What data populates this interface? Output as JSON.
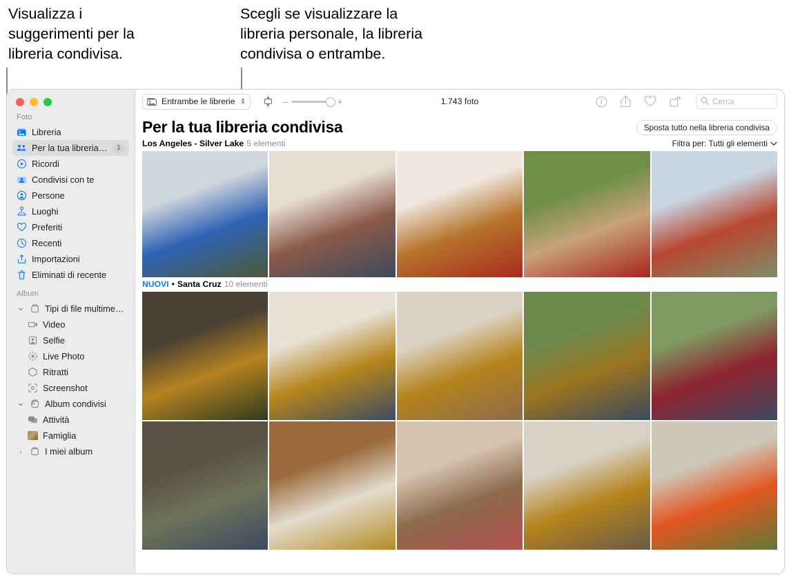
{
  "callouts": {
    "left": "Visualizza i\nsuggerimenti per la\nlibreria condivisa.",
    "right": "Scegli se visualizzare la\nlibreria personale, la libreria\ncondivisa o entrambe."
  },
  "window": {
    "traffic_lights": [
      "close",
      "minimize",
      "zoom"
    ]
  },
  "sidebar": {
    "sections": [
      {
        "title": "Foto",
        "items": [
          {
            "label": "Libreria",
            "icon": "library-icon",
            "badge": null,
            "selected": false
          },
          {
            "label": "Per la tua libreria condivisa",
            "icon": "shared-library-icon",
            "badge": "1",
            "selected": true
          },
          {
            "label": "Ricordi",
            "icon": "memories-icon",
            "badge": null,
            "selected": false
          },
          {
            "label": "Condivisi con te",
            "icon": "shared-with-you-icon",
            "badge": null,
            "selected": false
          },
          {
            "label": "Persone",
            "icon": "people-icon",
            "badge": null,
            "selected": false
          },
          {
            "label": "Luoghi",
            "icon": "places-icon",
            "badge": null,
            "selected": false
          },
          {
            "label": "Preferiti",
            "icon": "heart-icon",
            "badge": null,
            "selected": false
          },
          {
            "label": "Recenti",
            "icon": "clock-icon",
            "badge": null,
            "selected": false
          },
          {
            "label": "Importazioni",
            "icon": "import-icon",
            "badge": null,
            "selected": false
          },
          {
            "label": "Eliminati di recente",
            "icon": "trash-icon",
            "badge": null,
            "selected": false
          }
        ]
      },
      {
        "title": "Album",
        "items": [
          {
            "label": "Tipi di file multimediali",
            "icon": "album-folder-icon",
            "disclosure": "expanded",
            "selected": false
          },
          {
            "label": "Video",
            "icon": "video-icon",
            "sub": true,
            "selected": false
          },
          {
            "label": "Selfie",
            "icon": "selfie-icon",
            "sub": true,
            "selected": false
          },
          {
            "label": "Live Photo",
            "icon": "live-photo-icon",
            "sub": true,
            "selected": false
          },
          {
            "label": "Ritratti",
            "icon": "portrait-icon",
            "sub": true,
            "selected": false
          },
          {
            "label": "Screenshot",
            "icon": "screenshot-icon",
            "sub": true,
            "selected": false
          },
          {
            "label": "Album condivisi",
            "icon": "shared-album-icon",
            "disclosure": "expanded",
            "selected": false
          },
          {
            "label": "Attività",
            "icon": "activity-icon",
            "sub": true,
            "selected": false
          },
          {
            "label": "Famiglia",
            "icon": "album-thumbnail-icon",
            "sub": true,
            "selected": false
          },
          {
            "label": "I miei album",
            "icon": "album-folder-icon",
            "disclosure": "collapsed",
            "selected": false
          }
        ]
      }
    ]
  },
  "toolbar": {
    "library_selector": {
      "label": "Entrambe le librerie",
      "icon": "library-switch-icon"
    },
    "aspect_button_icon": "aspect-ratio-icon",
    "zoom": {
      "minus": "–",
      "plus": "+",
      "value_percent": 82
    },
    "photo_count": "1.743 foto",
    "icons": [
      {
        "name": "info-icon",
        "glyph": "i"
      },
      {
        "name": "share-icon",
        "glyph": "share"
      },
      {
        "name": "favorite-icon",
        "glyph": "heart"
      },
      {
        "name": "rotate-icon",
        "glyph": "rotate"
      }
    ],
    "search": {
      "placeholder": "Cerca",
      "value": "",
      "icon": "search-icon"
    }
  },
  "main": {
    "page_title": "Per la tua libreria condivisa",
    "move_all_button": "Sposta tutto nella libreria condivisa",
    "filter": {
      "label": "Filtra per: Tutti gli elementi",
      "icon": "chevron-down-icon"
    },
    "sections": [
      {
        "new_label": "",
        "separator": "",
        "place": "Los Angeles - Silver Lake",
        "count": "5 elementi",
        "rows": 1,
        "photos": [
          {
            "alt": "bambino con le braccia alzate alla finestra blu",
            "c1": "#cfd6dd",
            "c2": "#2f63b5",
            "c3": "#4d5a34"
          },
          {
            "alt": "due bambini seduti sul letto",
            "c1": "#e6ddd1",
            "c2": "#8b5a4a",
            "c3": "#3c4a5c"
          },
          {
            "alt": "bambino che suona la chitarra",
            "c1": "#efe7de",
            "c2": "#b6742c",
            "c3": "#aa2a1e"
          },
          {
            "alt": "bambino sorridente all'aperto",
            "c1": "#6f8f46",
            "c2": "#c8a27a",
            "c3": "#a8241c"
          },
          {
            "alt": "bambino con megafono blu",
            "c1": "#c9d6e4",
            "c2": "#b7472f",
            "c3": "#7f8e6b"
          }
        ]
      },
      {
        "new_label": "NUOVI",
        "separator": "•",
        "place": "Santa Cruz",
        "count": "10 elementi",
        "rows": 2,
        "photos": [
          {
            "alt": "donna che impasta in cucina con piante",
            "c1": "#4a4033",
            "c2": "#b58320",
            "c3": "#2e3a22"
          },
          {
            "alt": "donna aiuta bambino a impastare",
            "c1": "#e7e1d6",
            "c2": "#b6861d",
            "c3": "#3c4b63"
          },
          {
            "alt": "donna che ride mentre impasta",
            "c1": "#dcd3c5",
            "c2": "#b5841c",
            "c3": "#8d6a4c"
          },
          {
            "alt": "bambini che giocano davanti alla finestra",
            "c1": "#6d8a4d",
            "c2": "#9a7420",
            "c3": "#3a4a60"
          },
          {
            "alt": "due bambini davanti alla porta finestra",
            "c1": "#7f9a62",
            "c2": "#8e2430",
            "c3": "#3d4a62"
          },
          {
            "alt": "bambino che mangia un pezzo di frutta",
            "c1": "#5a5044",
            "c2": "#6e7358",
            "c3": "#3c4a63"
          },
          {
            "alt": "mani che impastano sul tavolo di legno",
            "c1": "#9a6a3c",
            "c2": "#e3dccd",
            "c3": "#b58a22"
          },
          {
            "alt": "bambino con le mani infarinate sul viso",
            "c1": "#d5c2b0",
            "c2": "#8d6a4c",
            "c3": "#b3524f"
          },
          {
            "alt": "donna che sorride in cucina",
            "c1": "#d8d2c6",
            "c2": "#b5841c",
            "c3": "#6a5a49"
          },
          {
            "alt": "bambino e neonata con tulipani arancioni",
            "c1": "#cfc7b8",
            "c2": "#e2561f",
            "c3": "#5f7a3a"
          }
        ]
      }
    ]
  }
}
